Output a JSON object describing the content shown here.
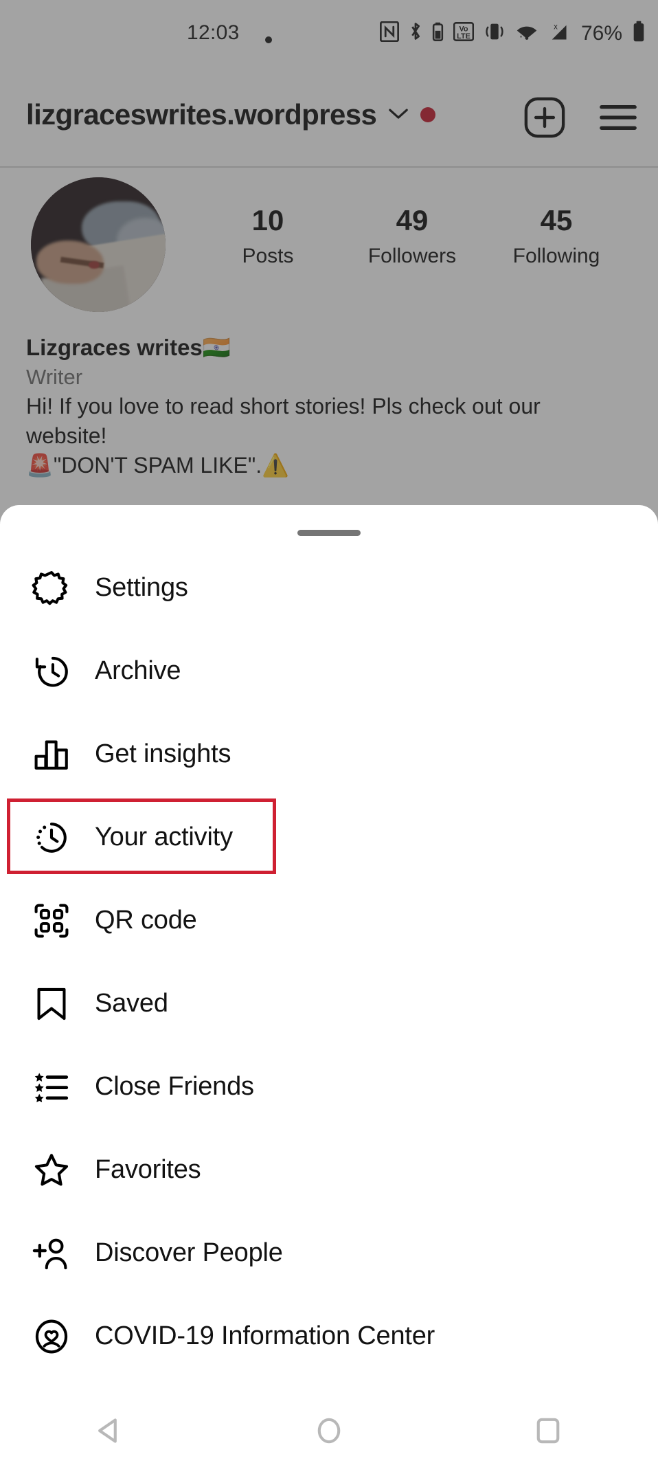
{
  "status_bar": {
    "time": "12:03",
    "notification_dot": "dot-indicator",
    "icons": [
      "nfc-icon",
      "bluetooth-icon",
      "bluetooth-battery-icon",
      "volte-icon",
      "vibrate-icon",
      "wifi-icon",
      "no-signal-icon"
    ],
    "battery_percent": "76%",
    "battery_icon": "battery-icon"
  },
  "header": {
    "username": "lizgraceswrites.wordpress",
    "dropdown_icon": "chevron-down-icon",
    "unread_indicator": "red-dot",
    "add_icon": "plus-square-icon",
    "menu_icon": "hamburger-menu-icon"
  },
  "profile": {
    "avatar": "profile-photo-hand-writing-notebook",
    "stats": [
      {
        "value": "10",
        "label": "Posts"
      },
      {
        "value": "49",
        "label": "Followers"
      },
      {
        "value": "45",
        "label": "Following"
      }
    ],
    "display_name": "Lizgraces writes🇮🇳",
    "category": "Writer",
    "bio_line_1": "Hi! If you love to read short stories! Pls check out our",
    "bio_line_2": "website!",
    "bio_line_3": "🚨\"DON'T SPAM LIKE\".⚠️"
  },
  "sheet": {
    "handle": "drag-handle",
    "items": [
      {
        "label": "Settings",
        "icon": "gear-icon"
      },
      {
        "label": "Archive",
        "icon": "archive-clock-icon"
      },
      {
        "label": "Get insights",
        "icon": "bar-chart-icon"
      },
      {
        "label": "Your activity",
        "icon": "activity-clock-icon"
      },
      {
        "label": "QR code",
        "icon": "qr-code-icon"
      },
      {
        "label": "Saved",
        "icon": "bookmark-icon"
      },
      {
        "label": "Close Friends",
        "icon": "star-list-icon"
      },
      {
        "label": "Favorites",
        "icon": "star-icon"
      },
      {
        "label": "Discover People",
        "icon": "add-person-icon"
      },
      {
        "label": "COVID-19 Information Center",
        "icon": "heart-shield-icon"
      }
    ]
  },
  "annotation": {
    "highlighted_item": "Your activity",
    "color": "#cf2032"
  },
  "nav_bar": {
    "back": "back-triangle-icon",
    "home": "home-circle-icon",
    "recents": "recents-square-icon"
  },
  "colors": {
    "accent_red": "#c5192d",
    "scrim": "rgba(60,60,60,0.47)",
    "sheet_bg": "#ffffff",
    "text_primary": "#121212",
    "text_secondary": "#6a6a6a"
  }
}
